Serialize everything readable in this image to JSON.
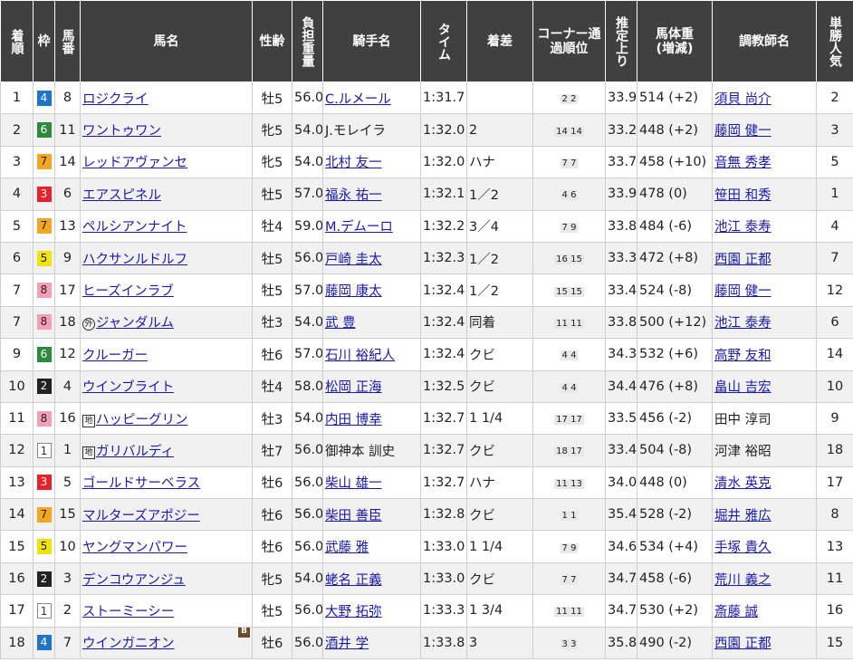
{
  "headers": {
    "chakujun": "着順",
    "waku": "枠",
    "umaban": "馬番",
    "bamei": "馬名",
    "seirei": "性齢",
    "futan": "負担重量",
    "kishu": "騎手名",
    "time": "タイム",
    "chakusa": "着差",
    "corner": "コーナー通過順位",
    "agari": "推定上り",
    "bataiju": "馬体重",
    "bataiju_sub": "(増減)",
    "chokyoshi": "調教師名",
    "ninki": "単勝人気"
  },
  "rows": [
    {
      "pos": "1",
      "waku": "4",
      "uma": "8",
      "name": "ロジクライ",
      "mark": "",
      "sex": "牡5",
      "wt": "56.0",
      "jockey": "C.ルメール",
      "jlink": true,
      "time": "1:31.7",
      "margin": "",
      "corner": "2 2",
      "agari": "33.9",
      "body": "514 (+2)",
      "trainer": "須貝 尚介",
      "tlink": true,
      "pop": "2"
    },
    {
      "pos": "2",
      "waku": "6",
      "uma": "11",
      "name": "ワントゥワン",
      "mark": "",
      "sex": "牝5",
      "wt": "54.0",
      "jockey": "J.モレイラ",
      "jlink": false,
      "time": "1:32.0",
      "margin": "2",
      "corner": "14 14",
      "agari": "33.2",
      "body": "448 (+2)",
      "trainer": "藤岡 健一",
      "tlink": true,
      "pop": "3"
    },
    {
      "pos": "3",
      "waku": "7",
      "uma": "14",
      "name": "レッドアヴァンセ",
      "mark": "",
      "sex": "牝5",
      "wt": "54.0",
      "jockey": "北村 友一",
      "jlink": true,
      "time": "1:32.0",
      "margin": "ハナ",
      "corner": "7 7",
      "agari": "33.7",
      "body": "458 (+10)",
      "trainer": "音無 秀孝",
      "tlink": true,
      "pop": "5"
    },
    {
      "pos": "4",
      "waku": "3",
      "uma": "6",
      "name": "エアスピネル",
      "mark": "",
      "sex": "牡5",
      "wt": "57.0",
      "jockey": "福永 祐一",
      "jlink": true,
      "time": "1:32.1",
      "margin": "1／2",
      "corner": "4 6",
      "agari": "33.9",
      "body": "478 (0)",
      "trainer": "笹田 和秀",
      "tlink": true,
      "pop": "1"
    },
    {
      "pos": "5",
      "waku": "7",
      "uma": "13",
      "name": "ペルシアンナイト",
      "mark": "",
      "sex": "牡4",
      "wt": "59.0",
      "jockey": "M.デムーロ",
      "jlink": true,
      "time": "1:32.2",
      "margin": "3／4",
      "corner": "7 9",
      "agari": "33.8",
      "body": "484 (-6)",
      "trainer": "池江 泰寿",
      "tlink": true,
      "pop": "4"
    },
    {
      "pos": "6",
      "waku": "5",
      "uma": "9",
      "name": "ハクサンルドルフ",
      "mark": "",
      "sex": "牡5",
      "wt": "56.0",
      "jockey": "戸崎 圭太",
      "jlink": true,
      "time": "1:32.3",
      "margin": "1／2",
      "corner": "16 15",
      "agari": "33.3",
      "body": "472 (+8)",
      "trainer": "西園 正都",
      "tlink": true,
      "pop": "7"
    },
    {
      "pos": "7",
      "waku": "8",
      "uma": "17",
      "name": "ヒーズインラブ",
      "mark": "",
      "sex": "牡5",
      "wt": "57.0",
      "jockey": "藤岡 康太",
      "jlink": true,
      "time": "1:32.4",
      "margin": "1／2",
      "corner": "15 15",
      "agari": "33.4",
      "body": "524 (-8)",
      "trainer": "藤岡 健一",
      "tlink": true,
      "pop": "12"
    },
    {
      "pos": "7",
      "waku": "8",
      "uma": "18",
      "name": "ジャンダルム",
      "mark": "外",
      "sex": "牡3",
      "wt": "54.0",
      "jockey": "武 豊",
      "jlink": true,
      "time": "1:32.4",
      "margin": "同着",
      "corner": "11 11",
      "agari": "33.8",
      "body": "500 (+12)",
      "trainer": "池江 泰寿",
      "tlink": true,
      "pop": "6"
    },
    {
      "pos": "9",
      "waku": "6",
      "uma": "12",
      "name": "クルーガー",
      "mark": "",
      "sex": "牡6",
      "wt": "57.0",
      "jockey": "石川 裕紀人",
      "jlink": true,
      "time": "1:32.4",
      "margin": "クビ",
      "corner": "4 4",
      "agari": "34.3",
      "body": "532 (+6)",
      "trainer": "高野 友和",
      "tlink": true,
      "pop": "14"
    },
    {
      "pos": "10",
      "waku": "2",
      "uma": "4",
      "name": "ウインブライト",
      "mark": "",
      "sex": "牡4",
      "wt": "58.0",
      "jockey": "松岡 正海",
      "jlink": true,
      "time": "1:32.5",
      "margin": "クビ",
      "corner": "4 4",
      "agari": "34.4",
      "body": "476 (+8)",
      "trainer": "畠山 吉宏",
      "tlink": true,
      "pop": "10"
    },
    {
      "pos": "11",
      "waku": "8",
      "uma": "16",
      "name": "ハッピーグリン",
      "mark": "地",
      "sex": "牡3",
      "wt": "54.0",
      "jockey": "内田 博幸",
      "jlink": true,
      "time": "1:32.7",
      "margin": "1 1/4",
      "corner": "17 17",
      "agari": "33.5",
      "body": "456 (-2)",
      "trainer": "田中 淳司",
      "tlink": false,
      "pop": "9"
    },
    {
      "pos": "12",
      "waku": "1",
      "uma": "1",
      "name": "ガリバルディ",
      "mark": "地",
      "sex": "牡7",
      "wt": "56.0",
      "jockey": "御神本 訓史",
      "jlink": false,
      "time": "1:32.7",
      "margin": "クビ",
      "corner": "18 17",
      "agari": "33.4",
      "body": "504 (-8)",
      "trainer": "河津 裕昭",
      "tlink": false,
      "pop": "18"
    },
    {
      "pos": "13",
      "waku": "3",
      "uma": "5",
      "name": "ゴールドサーベラス",
      "mark": "",
      "sex": "牡6",
      "wt": "56.0",
      "jockey": "柴山 雄一",
      "jlink": true,
      "time": "1:32.7",
      "margin": "ハナ",
      "corner": "11 13",
      "agari": "34.0",
      "body": "448 (0)",
      "trainer": "清水 英克",
      "tlink": true,
      "pop": "17"
    },
    {
      "pos": "14",
      "waku": "7",
      "uma": "15",
      "name": "マルターズアポジー",
      "mark": "",
      "sex": "牡6",
      "wt": "56.0",
      "jockey": "柴田 善臣",
      "jlink": true,
      "time": "1:32.8",
      "margin": "クビ",
      "corner": "1 1",
      "agari": "35.4",
      "body": "528 (-2)",
      "trainer": "堀井 雅広",
      "tlink": true,
      "pop": "8"
    },
    {
      "pos": "15",
      "waku": "5",
      "uma": "10",
      "name": "ヤングマンパワー",
      "mark": "",
      "sex": "牡6",
      "wt": "56.0",
      "jockey": "武藤 雅",
      "jlink": true,
      "time": "1:33.0",
      "margin": "1 1/4",
      "corner": "7 9",
      "agari": "34.6",
      "body": "534 (+4)",
      "trainer": "手塚 貴久",
      "tlink": true,
      "pop": "13"
    },
    {
      "pos": "16",
      "waku": "2",
      "uma": "3",
      "name": "デンコウアンジュ",
      "mark": "",
      "sex": "牝5",
      "wt": "54.0",
      "jockey": "蛯名 正義",
      "jlink": true,
      "time": "1:33.0",
      "margin": "クビ",
      "corner": "7 7",
      "agari": "34.7",
      "body": "458 (-6)",
      "trainer": "荒川 義之",
      "tlink": true,
      "pop": "11"
    },
    {
      "pos": "17",
      "waku": "1",
      "uma": "2",
      "name": "ストーミーシー",
      "mark": "",
      "sex": "牡5",
      "wt": "56.0",
      "jockey": "大野 拓弥",
      "jlink": true,
      "time": "1:33.3",
      "margin": "1 3/4",
      "corner": "11 11",
      "agari": "34.7",
      "body": "530 (+2)",
      "trainer": "斎藤 誠",
      "tlink": true,
      "pop": "16"
    },
    {
      "pos": "18",
      "waku": "4",
      "uma": "7",
      "name": "ウインガニオン",
      "mark": "",
      "blinker": "B",
      "sex": "牡6",
      "wt": "56.0",
      "jockey": "酒井 学",
      "jlink": true,
      "time": "1:33.8",
      "margin": "3",
      "corner": "3 3",
      "agari": "35.8",
      "body": "490 (-2)",
      "trainer": "西園 正都",
      "tlink": true,
      "pop": "15"
    }
  ]
}
